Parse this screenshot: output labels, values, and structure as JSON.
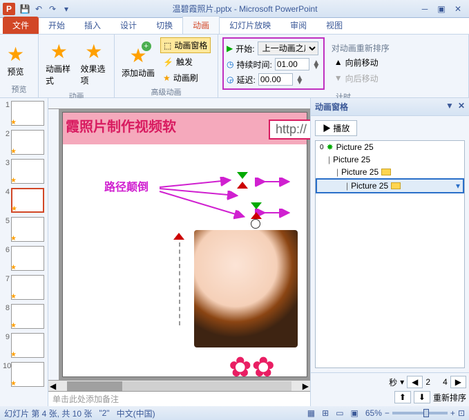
{
  "app": {
    "title": "温碧霞照片.pptx - Microsoft PowerPoint"
  },
  "tabs": {
    "file": "文件",
    "home": "开始",
    "insert": "插入",
    "design": "设计",
    "transitions": "切换",
    "animations": "动画",
    "slideshow": "幻灯片放映",
    "review": "审阅",
    "view": "视图"
  },
  "ribbon": {
    "preview": {
      "label": "预览",
      "btn": "预览"
    },
    "animation": {
      "label": "动画",
      "style": "动画样式",
      "effect": "效果选项"
    },
    "advanced": {
      "label": "高级动画",
      "add": "添加动画",
      "pane": "动画窗格",
      "trigger": "触发",
      "painter": "动画刷"
    },
    "timing": {
      "label": "计时",
      "start_lbl": "开始:",
      "start_val": "上一动画之后",
      "duration_lbl": "持续时间:",
      "duration_val": "01.00",
      "delay_lbl": "延迟:",
      "delay_val": "00.00",
      "reorder": "对动画重新排序",
      "up": "向前移动",
      "down": "向后移动"
    }
  },
  "slide": {
    "banner": "霞照片制作视频软",
    "url": "http://",
    "annotation": "路径颠倒",
    "notes": "单击此处添加备注"
  },
  "pane": {
    "title": "动画窗格",
    "play": "▶ 播放",
    "items": [
      {
        "icon": "✸",
        "label": "Picture 25",
        "indent": 0,
        "bar": false
      },
      {
        "icon": "|",
        "label": "Picture 25",
        "indent": 1,
        "bar": false
      },
      {
        "icon": "|",
        "label": "Picture 25",
        "indent": 2,
        "bar": true
      },
      {
        "icon": "|",
        "label": "Picture 25",
        "indent": 3,
        "bar": true,
        "sel": true
      }
    ],
    "seconds": "秒",
    "sec_left": "2",
    "sec_right": "4",
    "reorder": "重新排序"
  },
  "thumbs": {
    "count": 10,
    "selected": 4
  },
  "status": {
    "slide": "幻灯片 第 4 张, 共 10 张",
    "theme": "\"2\"",
    "lang": "中文(中国)",
    "zoom": "65%"
  }
}
